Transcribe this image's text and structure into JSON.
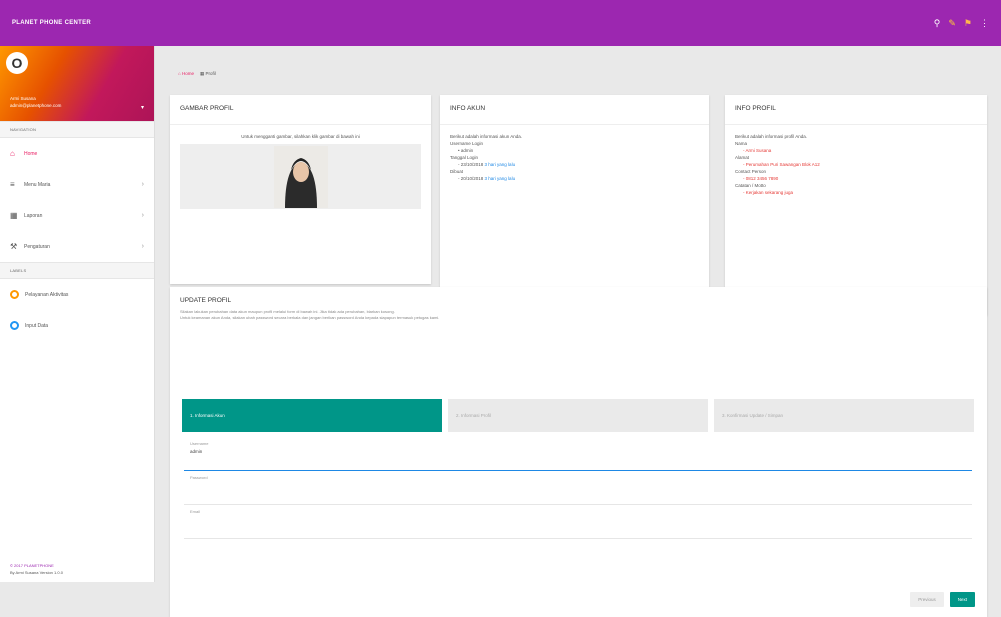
{
  "topbar": {
    "brand": "PLANET PHONE CENTER",
    "icons": [
      "search-icon",
      "pen-icon",
      "bell-icon",
      "more-icon"
    ]
  },
  "sidebar": {
    "avatar_letter": "O",
    "user_name": "Armi Susana",
    "user_email": "admin@planetphone.com",
    "nav_header": "NAVIGATION",
    "items": [
      {
        "label": "Home",
        "icon": "home-icon"
      },
      {
        "label": "Menu Maria",
        "icon": "menu-icon"
      },
      {
        "label": "Laporan",
        "icon": "report-icon"
      },
      {
        "label": "Pengaturan",
        "icon": "wrench-icon"
      }
    ],
    "labels_header": "LABELS",
    "labels": [
      {
        "label": "Pelayanan Aktivitas",
        "color": "#ff9800"
      },
      {
        "label": "Input Data",
        "color": "#2196f3"
      }
    ],
    "copyright": "© 2017 PLANETPHONE",
    "version": "By Armi Susana Version 1.0.0"
  },
  "breadcrumb": {
    "home": "Home",
    "current": "Profil"
  },
  "card_gambar": {
    "title": "GAMBAR PROFIL",
    "instruction": "Untuk mengganti gambar, silahkan klik gambar di bawah ini"
  },
  "card_akun": {
    "title": "INFO AKUN",
    "intro": "Berikut adalah informasi akun Anda.",
    "username_label": "Username Login",
    "username": "admin",
    "last_login_label": "Tanggal Login",
    "last_login": "- 23/10/2018",
    "last_login_link": "3 hari yang lalu",
    "created_label": "Dibuat",
    "created": "- 20/10/2018",
    "created_link": "3 hari yang lalu"
  },
  "card_profil": {
    "title": "INFO PROFIL",
    "intro": "Berikut adalah informasi profil Anda.",
    "name_label": "Nama",
    "name": "- Armi Susana",
    "address_label": "Alamat",
    "address": "- Perumahan Puri Sawangan Blok A12",
    "contact_label": "Contact Person",
    "contact": "- 0812 3456 7890",
    "status_label": "Catatan / Motto",
    "status": "- Kerjakan sekarang juga"
  },
  "update": {
    "title": "UPDATE PROFIL",
    "desc1": "Silakan lakukan perubahan data akun maupun profil melalui form di bawah ini. Jika tidak ada perubahan, biarkan kosong.",
    "desc2": "Untuk keamanan akun Anda, silakan ubah password secara berkala dan jangan berikan password Anda kepada siapapun termasuk petugas kami.",
    "steps": [
      "1. Informasi Akun",
      "2. Informasi Profil",
      "3. Konfirmasi Update / Simpan"
    ],
    "fields": [
      {
        "label": "Username",
        "value": "admin"
      },
      {
        "label": "Password",
        "value": ""
      },
      {
        "label": "Email",
        "value": ""
      }
    ],
    "prev_label": "Previous",
    "next_label": "Next"
  }
}
